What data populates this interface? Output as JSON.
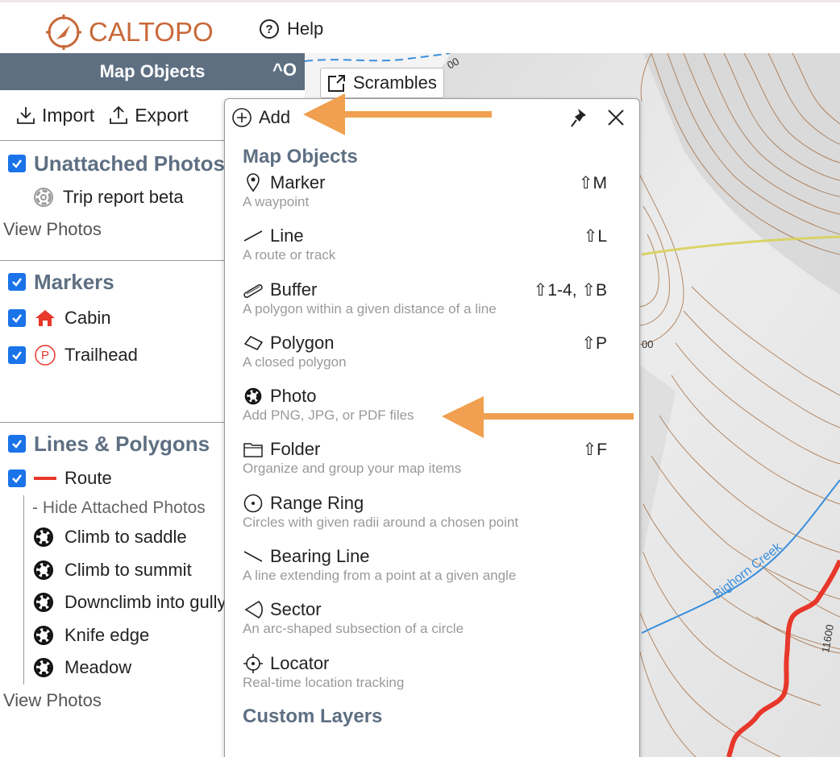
{
  "header": {
    "logo_text_part1": "CAL",
    "logo_text_part2": "TOPO",
    "help_label": "Help"
  },
  "sidebar": {
    "title": "Map Objects",
    "collapse_label": "^O",
    "import_label": "Import",
    "export_label": "Export",
    "sections": {
      "unattached": {
        "title": "Unattached Photos",
        "items": [
          {
            "label": "Trip report beta"
          }
        ],
        "view_photos": "View Photos"
      },
      "markers": {
        "title": "Markers",
        "items": [
          {
            "label": "Cabin"
          },
          {
            "label": "Trailhead"
          }
        ]
      },
      "lines": {
        "title": "Lines & Polygons",
        "route_label": "Route",
        "hide_photos": "- Hide Attached Photos",
        "photos": [
          {
            "label": "Climb to saddle"
          },
          {
            "label": "Climb to summit"
          },
          {
            "label": "Downclimb into gully"
          },
          {
            "label": "Knife edge"
          },
          {
            "label": "Meadow"
          }
        ],
        "view_photos": "View Photos"
      }
    }
  },
  "map": {
    "scrambles_label": "Scrambles",
    "creek_label": "Bighorn Creek",
    "contour_label_1": "00",
    "contour_label_2": "11600",
    "contour_label_3": "00"
  },
  "add_panel": {
    "title": "Add",
    "section_map_objects": "Map Objects",
    "items": [
      {
        "label": "Marker",
        "desc": "A waypoint",
        "shortcut": "⇧M",
        "icon": "marker-pin-icon"
      },
      {
        "label": "Line",
        "desc": "A route or track",
        "shortcut": "⇧L",
        "icon": "line-icon"
      },
      {
        "label": "Buffer",
        "desc": "A polygon within a given distance of a line",
        "shortcut": "⇧1-4, ⇧B",
        "icon": "buffer-icon"
      },
      {
        "label": "Polygon",
        "desc": "A closed polygon",
        "shortcut": "⇧P",
        "icon": "polygon-icon"
      },
      {
        "label": "Photo",
        "desc": "Add PNG, JPG, or PDF files",
        "shortcut": "",
        "icon": "camera-aperture-icon"
      },
      {
        "label": "Folder",
        "desc": "Organize and group your map items",
        "shortcut": "⇧F",
        "icon": "folder-icon"
      },
      {
        "label": "Range Ring",
        "desc": "Circles with given radii around a chosen point",
        "shortcut": "",
        "icon": "range-ring-icon"
      },
      {
        "label": "Bearing Line",
        "desc": "A line extending from a point at a given angle",
        "shortcut": "",
        "icon": "bearing-line-icon"
      },
      {
        "label": "Sector",
        "desc": "An arc-shaped subsection of a circle",
        "shortcut": "",
        "icon": "sector-icon"
      },
      {
        "label": "Locator",
        "desc": "Real-time location tracking",
        "shortcut": "",
        "icon": "locator-crosshair-icon"
      }
    ],
    "section_custom_layers": "Custom Layers"
  },
  "colors": {
    "brand": "#c8693a",
    "sidebar_header": "#5e6f82",
    "checkbox": "#1a73e8",
    "arrow": "#f0a050",
    "route_red": "#e8372b",
    "creek_blue": "#3a8fdc"
  }
}
